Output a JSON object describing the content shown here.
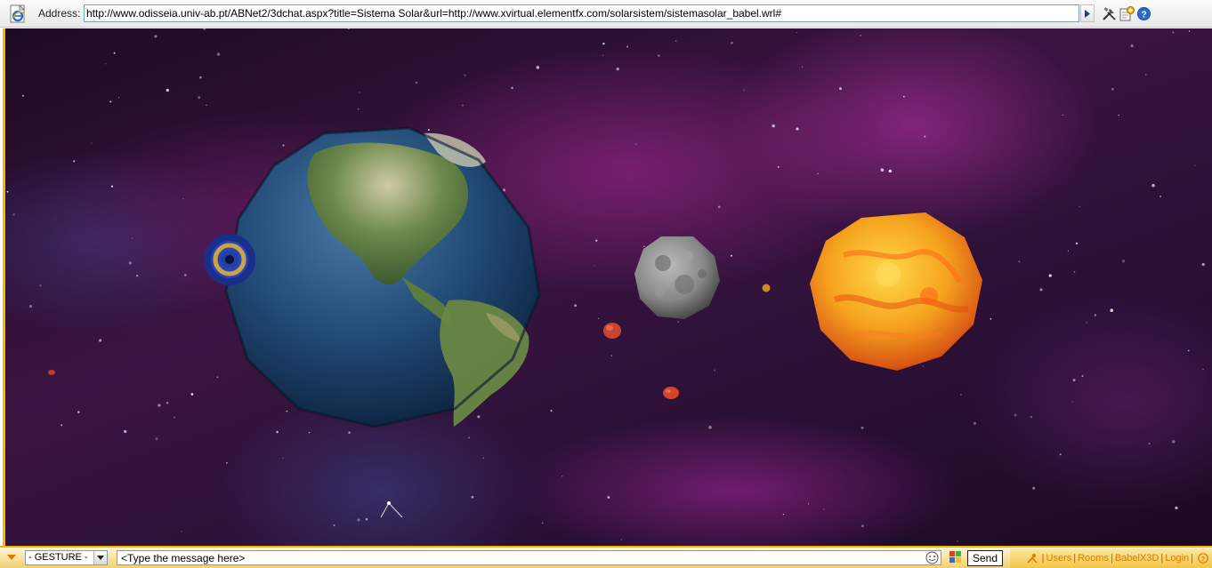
{
  "address_bar": {
    "label": "Address:",
    "url": "http://www.odisseia.univ-ab.pt/ABNet2/3dchat.aspx?title=Sistema Solar&url=http://www.xvirtual.elementfx.com/solarsistem/sistemasolar_babel.wrl#"
  },
  "toolbar": {
    "icons": [
      "ie-page-icon",
      "go-arrow-icon",
      "tools-icon",
      "add-page-icon",
      "help-icon"
    ]
  },
  "scene": {
    "objects": [
      "earth",
      "navigation-target",
      "moon",
      "sun",
      "red-planet",
      "red-planet-small",
      "small-planet",
      "cursor"
    ]
  },
  "chat_bar": {
    "gesture_value": "- GESTURE -",
    "message_placeholder": "<Type the message here>",
    "send_label": "Send"
  },
  "menu": {
    "users": "Users",
    "rooms": "Rooms",
    "babelx3d": "BabelX3D",
    "login": "Login"
  },
  "colors": {
    "accent": "#f5b800",
    "menu_text": "#e07800"
  }
}
